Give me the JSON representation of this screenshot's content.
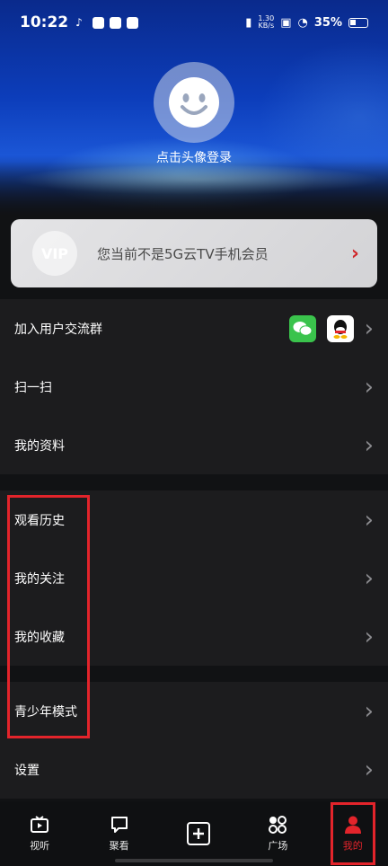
{
  "status_bar": {
    "time": "10:22",
    "net_speed_value": "1.30",
    "net_speed_unit": "KB/s",
    "battery": "35%"
  },
  "profile": {
    "login_text": "点击头像登录"
  },
  "vip": {
    "badge_text": "VIP",
    "message": "您当前不是5G云TV手机会员"
  },
  "menu_group_1": [
    {
      "label": "加入用户交流群"
    },
    {
      "label": "扫一扫"
    },
    {
      "label": "我的资料"
    }
  ],
  "menu_group_2": [
    {
      "label": "观看历史"
    },
    {
      "label": "我的关注"
    },
    {
      "label": "我的收藏"
    }
  ],
  "menu_group_3": [
    {
      "label": "青少年模式"
    },
    {
      "label": "设置"
    }
  ],
  "bottom_nav": [
    {
      "label": "视听",
      "icon": "tv-icon"
    },
    {
      "label": "聚看",
      "icon": "chat-icon"
    },
    {
      "label": "",
      "icon": "add-icon"
    },
    {
      "label": "广场",
      "icon": "grid-circles-icon"
    },
    {
      "label": "我的",
      "icon": "person-icon",
      "active": true
    }
  ],
  "colors": {
    "accent": "#e3242b",
    "background": "#111214",
    "row_bg": "#1c1c1e"
  }
}
